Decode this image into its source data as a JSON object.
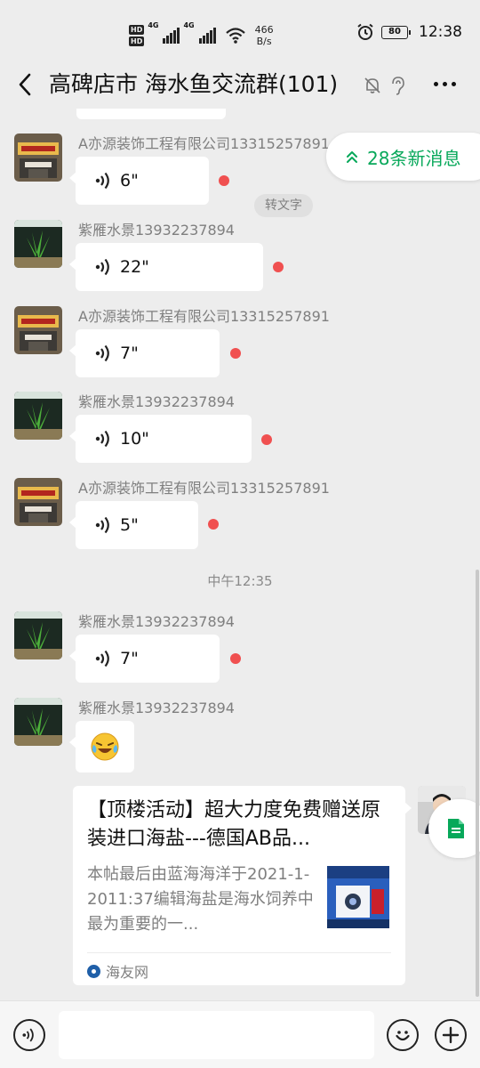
{
  "status_bar": {
    "network_speed_value": "466",
    "network_speed_unit": "B/s",
    "signal_labels": [
      "HD",
      "HD"
    ],
    "signal_gen": [
      "4G",
      "4G"
    ],
    "battery": "80",
    "time": "12:38"
  },
  "header": {
    "title": "高碑店市 海水鱼交流群(101)"
  },
  "new_messages": {
    "label": "28条新消息"
  },
  "messages": [
    {
      "sender": "A亦源装饰工程有限公司13315257891",
      "duration": "6\"",
      "unread": true,
      "to_text": "转文字"
    },
    {
      "sender": "紫雁水景13932237894",
      "duration": "22\"",
      "unread": true
    },
    {
      "sender": "A亦源装饰工程有限公司13315257891",
      "duration": "7\"",
      "unread": true
    },
    {
      "sender": "紫雁水景13932237894",
      "duration": "10\"",
      "unread": true
    },
    {
      "sender": "A亦源装饰工程有限公司13315257891",
      "duration": "5\"",
      "unread": true
    },
    {
      "time_divider": "中午12:35"
    },
    {
      "sender": "紫雁水景13932237894",
      "duration": "7\"",
      "unread": true
    },
    {
      "sender": "紫雁水景13932237894",
      "emoji": "laughing-crying"
    }
  ],
  "link_card": {
    "title": "【顶楼活动】超大力度免费赠送原装进口海盐---德国AB品...",
    "description": "本帖最后由蓝海海洋于2021-1-2011:37编辑海盐是海水饲养中最为重要的一...",
    "source": "海友网"
  },
  "input": {
    "placeholder": ""
  },
  "colors": {
    "accent_green": "#07a85a",
    "unread_red": "#f05050",
    "background": "#ededed"
  }
}
